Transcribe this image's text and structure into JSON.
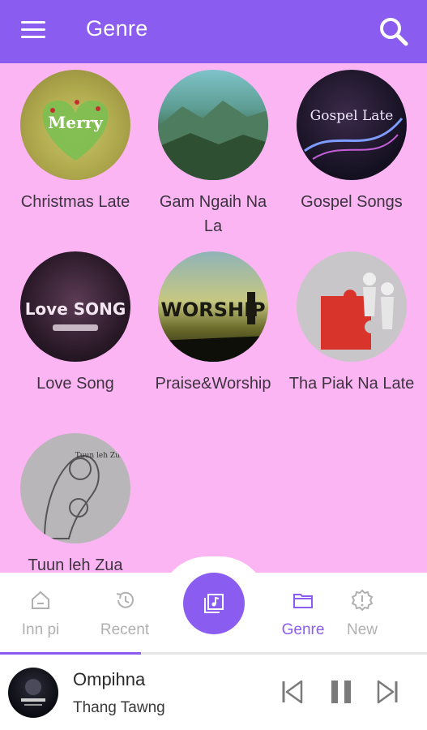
{
  "appbar": {
    "title": "Genre"
  },
  "genres": [
    {
      "label": "Christmas Late",
      "art_text": "Merry"
    },
    {
      "label": "Gam Ngaih Na La"
    },
    {
      "label": "Gospel Songs",
      "art_text": "Gospel Late"
    },
    {
      "label": "Love Song",
      "art_text": "Love SONG"
    },
    {
      "label": "Praise&Worship",
      "art_text": "WORSHIP"
    },
    {
      "label": "Tha Piak Na Late"
    },
    {
      "label": "Tuun leh Zua",
      "art_text": "Tuun leh Zua"
    }
  ],
  "nav": {
    "home": "Inn pi",
    "recent": "Recent",
    "genre": "Genre",
    "new": "New"
  },
  "player": {
    "song": "Ompihna",
    "artist": "Thang Tawng",
    "progress": 0.33
  },
  "colors": {
    "accent": "#8a5cf0",
    "background": "#fbb5f2"
  }
}
